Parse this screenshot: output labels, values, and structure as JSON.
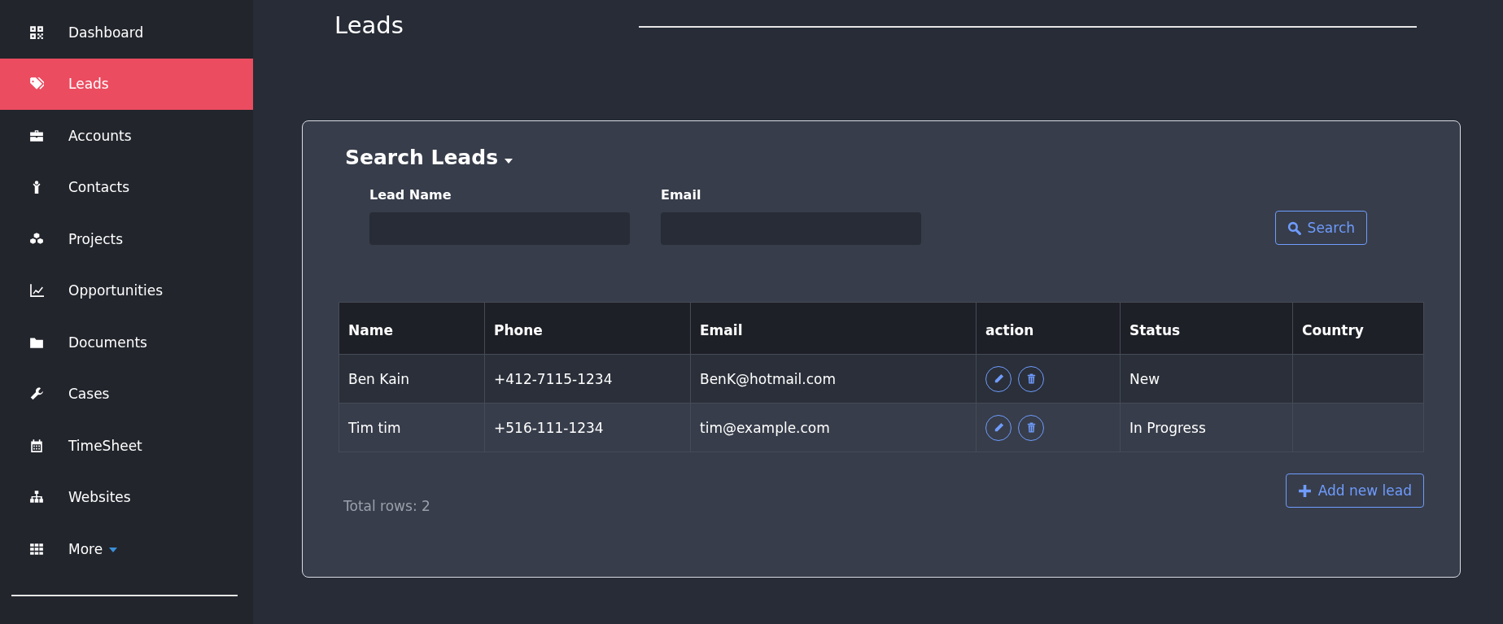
{
  "sidebar": {
    "items": [
      {
        "label": "Dashboard",
        "selected": false,
        "kind": "link"
      },
      {
        "label": "Leads",
        "selected": true,
        "kind": "link"
      },
      {
        "label": "Accounts",
        "selected": false,
        "kind": "link"
      },
      {
        "label": "Contacts",
        "selected": false,
        "kind": "link"
      },
      {
        "label": "Projects",
        "selected": false,
        "kind": "link"
      },
      {
        "label": "Opportunities",
        "selected": false,
        "kind": "link"
      },
      {
        "label": "Documents",
        "selected": false,
        "kind": "link"
      },
      {
        "label": "Cases",
        "selected": false,
        "kind": "link"
      },
      {
        "label": "TimeSheet",
        "selected": false,
        "kind": "link"
      },
      {
        "label": "Websites",
        "selected": false,
        "kind": "link"
      },
      {
        "label": "More",
        "selected": false,
        "kind": "dropdown"
      }
    ]
  },
  "page": {
    "title": "Leads"
  },
  "search_panel": {
    "title": "Search Leads",
    "fields": [
      {
        "label": "Lead Name"
      },
      {
        "label": "Email"
      }
    ],
    "search_button": "Search"
  },
  "table": {
    "columns": [
      "Name",
      "Phone",
      "Email",
      "action",
      "Status",
      "Country"
    ],
    "rows": [
      {
        "name": "Ben Kain",
        "phone": "+412-7115-1234",
        "email": "BenK@hotmail.com",
        "status": "New"
      },
      {
        "name": "Tim tim",
        "phone": "+516-111-1234",
        "email": "tim@example.com",
        "status": "In Progress"
      }
    ]
  },
  "footer": {
    "total": "Total rows: 2",
    "add_button": "Add new lead"
  }
}
